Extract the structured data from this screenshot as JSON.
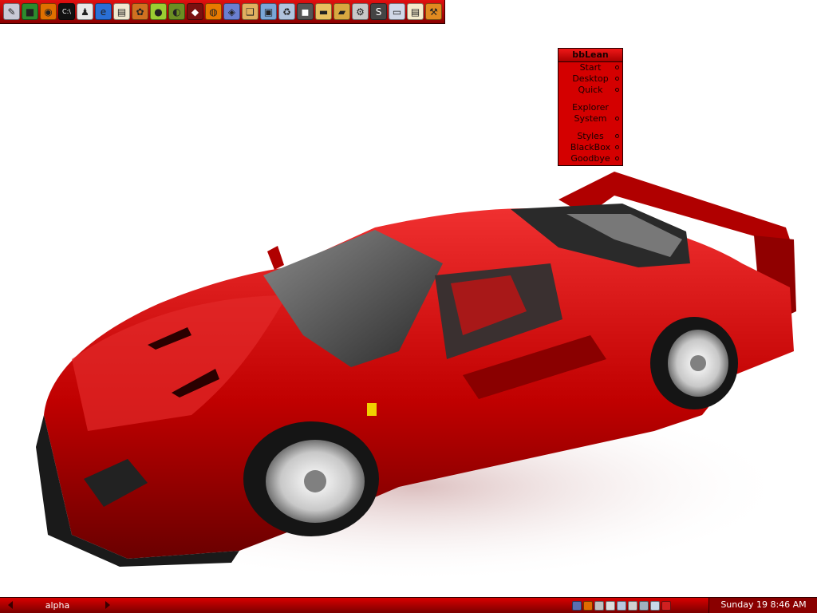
{
  "launchbar": {
    "icons": [
      {
        "name": "pen-icon",
        "glyph": "✎",
        "color": "#c9c9d6"
      },
      {
        "name": "green-square-icon",
        "glyph": "■",
        "color": "#2e8b2e"
      },
      {
        "name": "media-player-icon",
        "glyph": "◉",
        "color": "#e07000"
      },
      {
        "name": "terminal-icon",
        "glyph": "C:\\",
        "color": "#111111"
      },
      {
        "name": "tux-icon",
        "glyph": "♟",
        "color": "#e8e8e8"
      },
      {
        "name": "ie-icon",
        "glyph": "e",
        "color": "#2a6fd6"
      },
      {
        "name": "document-icon",
        "glyph": "▤",
        "color": "#f0e8d0"
      },
      {
        "name": "tool-icon",
        "glyph": "✿",
        "color": "#d07020"
      },
      {
        "name": "lime-circle-icon",
        "glyph": "●",
        "color": "#9acd32"
      },
      {
        "name": "winamp-icon",
        "glyph": "◐",
        "color": "#6b8e23"
      },
      {
        "name": "dark-app-icon",
        "glyph": "◆",
        "color": "#7a1010"
      },
      {
        "name": "firefox-icon",
        "glyph": "◍",
        "color": "#e87a00"
      },
      {
        "name": "network-icon",
        "glyph": "◈",
        "color": "#6a7fd0"
      },
      {
        "name": "folder-paper-icon",
        "glyph": "❑",
        "color": "#e0b060"
      },
      {
        "name": "computer-icon",
        "glyph": "▣",
        "color": "#7aa7d8"
      },
      {
        "name": "recycle-bin-icon",
        "glyph": "♻",
        "color": "#b0c4de"
      },
      {
        "name": "cube-icon",
        "glyph": "◼",
        "color": "#555555"
      },
      {
        "name": "folder-icon",
        "glyph": "▬",
        "color": "#e8c060"
      },
      {
        "name": "open-folder-icon",
        "glyph": "▰",
        "color": "#d8a840"
      },
      {
        "name": "settings-icon",
        "glyph": "⚙",
        "color": "#c8c8c8"
      },
      {
        "name": "soldat-icon",
        "glyph": "S",
        "color": "#444444"
      },
      {
        "name": "window-icon",
        "glyph": "▭",
        "color": "#d0d8e8"
      },
      {
        "name": "notes-icon",
        "glyph": "▤",
        "color": "#f4eccc"
      },
      {
        "name": "tools-icon",
        "glyph": "⚒",
        "color": "#e08a20"
      }
    ]
  },
  "menu": {
    "title": "bbLean",
    "items": [
      {
        "label": "Start",
        "submenu": true
      },
      {
        "label": "Desktop",
        "submenu": true
      },
      {
        "label": "Quick",
        "submenu": true
      },
      {
        "sep": true
      },
      {
        "label": "Explorer",
        "submenu": false
      },
      {
        "label": "System",
        "submenu": true
      },
      {
        "sep": true
      },
      {
        "label": "Styles",
        "submenu": true
      },
      {
        "label": "BlackBox",
        "submenu": true
      },
      {
        "label": "Goodbye",
        "submenu": true
      }
    ]
  },
  "toolbar": {
    "workspace": "alpha",
    "clock": "Sunday 19 8:46 AM",
    "tray": [
      {
        "name": "network-tray-icon",
        "color": "#5a6fb0"
      },
      {
        "name": "avast-tray-icon",
        "color": "#e06a00"
      },
      {
        "name": "shield-tray-icon",
        "color": "#c0c0c0"
      },
      {
        "name": "volume-tray-icon",
        "color": "#dddddd"
      },
      {
        "name": "monitor-tray-icon",
        "color": "#b8c8e0"
      },
      {
        "name": "printer-tray-icon",
        "color": "#d0d0d0"
      },
      {
        "name": "safely-remove-tray-icon",
        "color": "#a0b0c0"
      },
      {
        "name": "download-tray-icon",
        "color": "#c8d8e8"
      },
      {
        "name": "antivirus-tray-icon",
        "color": "#d02020"
      }
    ]
  },
  "colors": {
    "accent": "#d40000",
    "dark": "#200000"
  }
}
